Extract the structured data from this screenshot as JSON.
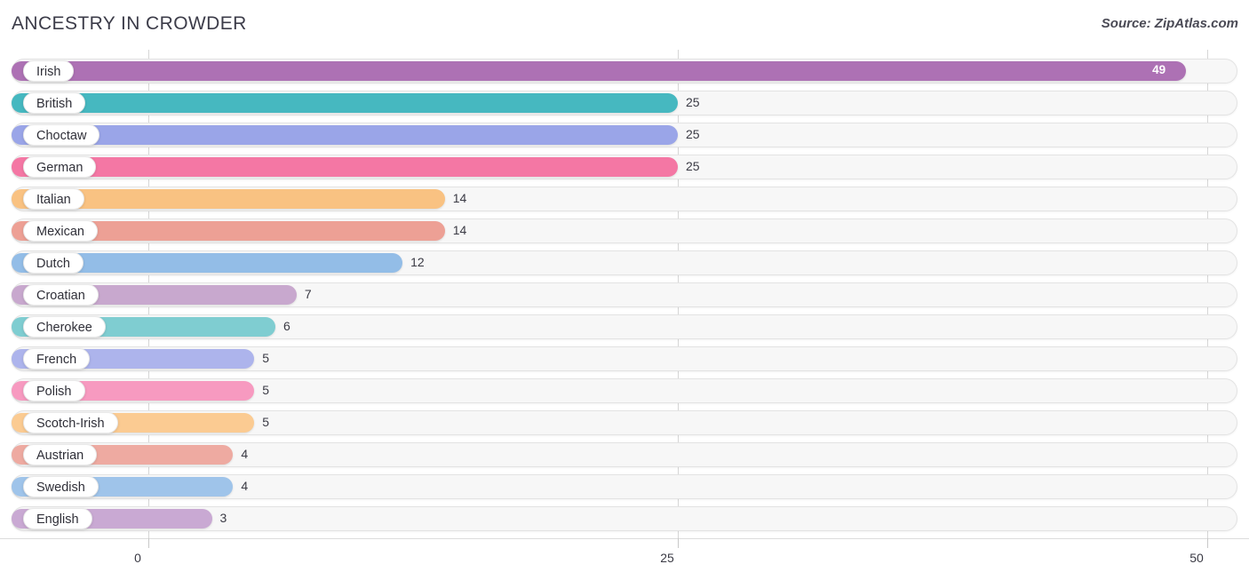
{
  "header": {
    "title": "ANCESTRY IN CROWDER",
    "source": "Source: ZipAtlas.com"
  },
  "chart_data": {
    "type": "bar",
    "orientation": "horizontal",
    "title": "ANCESTRY IN CROWDER",
    "xlabel": "",
    "ylabel": "",
    "xlim": [
      0,
      50
    ],
    "xticks": [
      0,
      25,
      50
    ],
    "xtick_labels": [
      "0",
      "25",
      "50"
    ],
    "grid": true,
    "legend": false,
    "categories": [
      "Irish",
      "British",
      "Choctaw",
      "German",
      "Italian",
      "Mexican",
      "Dutch",
      "Croatian",
      "Cherokee",
      "French",
      "Polish",
      "Scotch-Irish",
      "Austrian",
      "Swedish",
      "English"
    ],
    "values": [
      49,
      25,
      25,
      25,
      14,
      14,
      12,
      7,
      6,
      5,
      5,
      5,
      4,
      4,
      3
    ],
    "value_labels": [
      "49",
      "25",
      "25",
      "25",
      "14",
      "14",
      "12",
      "7",
      "6",
      "5",
      "5",
      "5",
      "4",
      "4",
      "3"
    ],
    "bar_colors": [
      "#ad71b4",
      "#46b8c0",
      "#9aa5e8",
      "#f477a4",
      "#f9c282",
      "#eda095",
      "#93bde7",
      "#c8a8ce",
      "#7fcdd1",
      "#adb4ec",
      "#f79ac0",
      "#fbcb92",
      "#eeaaa1",
      "#9fc4ea",
      "#c9a9d3"
    ],
    "track_color": "#f7f7f7",
    "track_border_color": "#e3e3e3",
    "gridline_color": "#d6d6d6"
  }
}
